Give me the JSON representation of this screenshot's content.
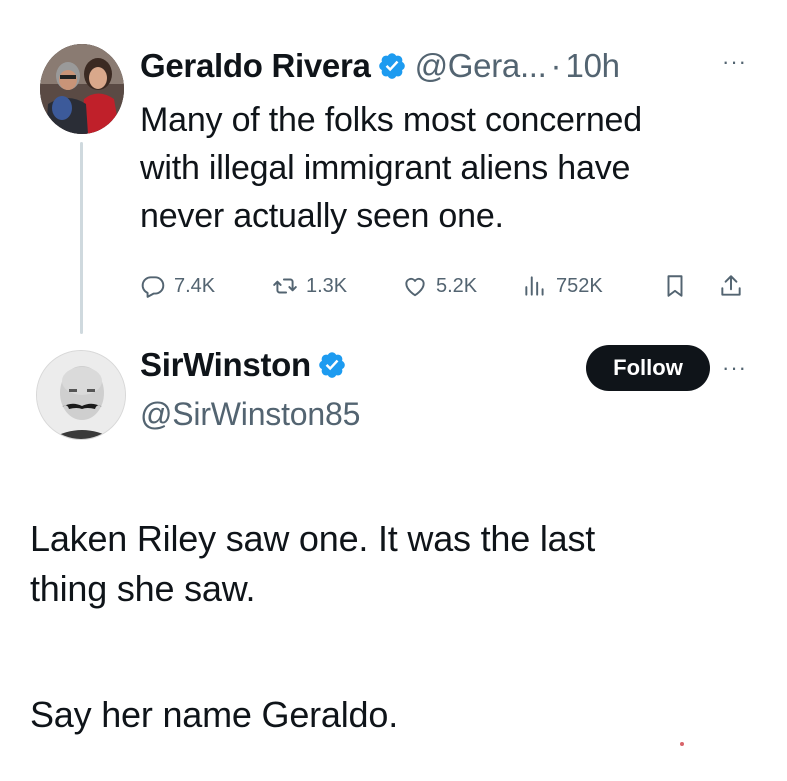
{
  "parent_tweet": {
    "display_name": "Geraldo Rivera",
    "handle": "@Gera...",
    "separator": "·",
    "time": "10h",
    "more": "···",
    "lines": [
      "Many of the folks most concerned",
      "with illegal immigrant aliens have",
      "never actually seen one."
    ],
    "metrics": {
      "replies": "7.4K",
      "reposts": "1.3K",
      "likes": "5.2K",
      "views": "752K"
    }
  },
  "reply_tweet": {
    "display_name": "SirWinston",
    "handle": "@SirWinston85",
    "follow_label": "Follow",
    "more": "···",
    "paragraph_1_lines": [
      "Laken Riley saw one. It was the last",
      "thing she saw."
    ],
    "paragraph_2": "Say her name Geraldo."
  },
  "colors": {
    "text": "#0f1419",
    "secondary": "#536471",
    "verified": "#1d9bf0",
    "thread_line": "#cfd9de",
    "follow_bg": "#0f1419"
  },
  "icons": [
    "reply-icon",
    "repost-icon",
    "like-icon",
    "views-icon",
    "bookmark-icon",
    "share-icon",
    "verified-badge-icon"
  ]
}
